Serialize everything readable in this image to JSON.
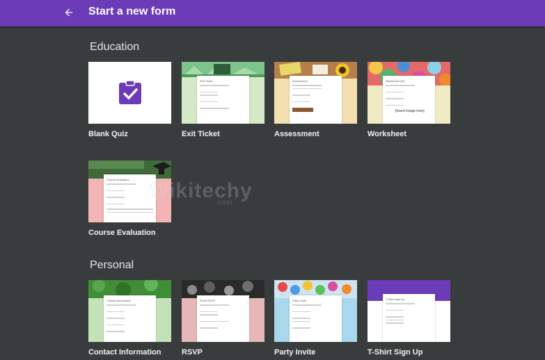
{
  "header": {
    "title": "Start a new form"
  },
  "sections": {
    "education": {
      "title": "Education",
      "templates": [
        {
          "label": "Blank Quiz"
        },
        {
          "label": "Exit Ticket",
          "preview_title": "Exit Ticket"
        },
        {
          "label": "Assessment",
          "preview_title": "Assessment"
        },
        {
          "label": "Worksheet",
          "preview_title": "Worksheet Unit",
          "preview_note": "[Insert image here]"
        },
        {
          "label": "Course Evaluation",
          "preview_title": "Course Evaluation"
        }
      ]
    },
    "personal": {
      "title": "Personal",
      "templates": [
        {
          "label": "Contact Information",
          "preview_title": "Contact Information"
        },
        {
          "label": "RSVP",
          "preview_title": "Event RSVP"
        },
        {
          "label": "Party Invite",
          "preview_title": "Party Invite"
        },
        {
          "label": "T-Shirt Sign Up",
          "preview_title": "T-Shirt Sign Up"
        }
      ]
    }
  },
  "watermark": {
    "main": "Wikitechy",
    "sub": ".com"
  },
  "colors": {
    "header": "#6b3bb8",
    "background": "#393c3d",
    "quiz_icon": "#6b3bb8"
  },
  "icons": {
    "back": "arrow-left-icon",
    "quiz": "clipboard-check-icon"
  }
}
